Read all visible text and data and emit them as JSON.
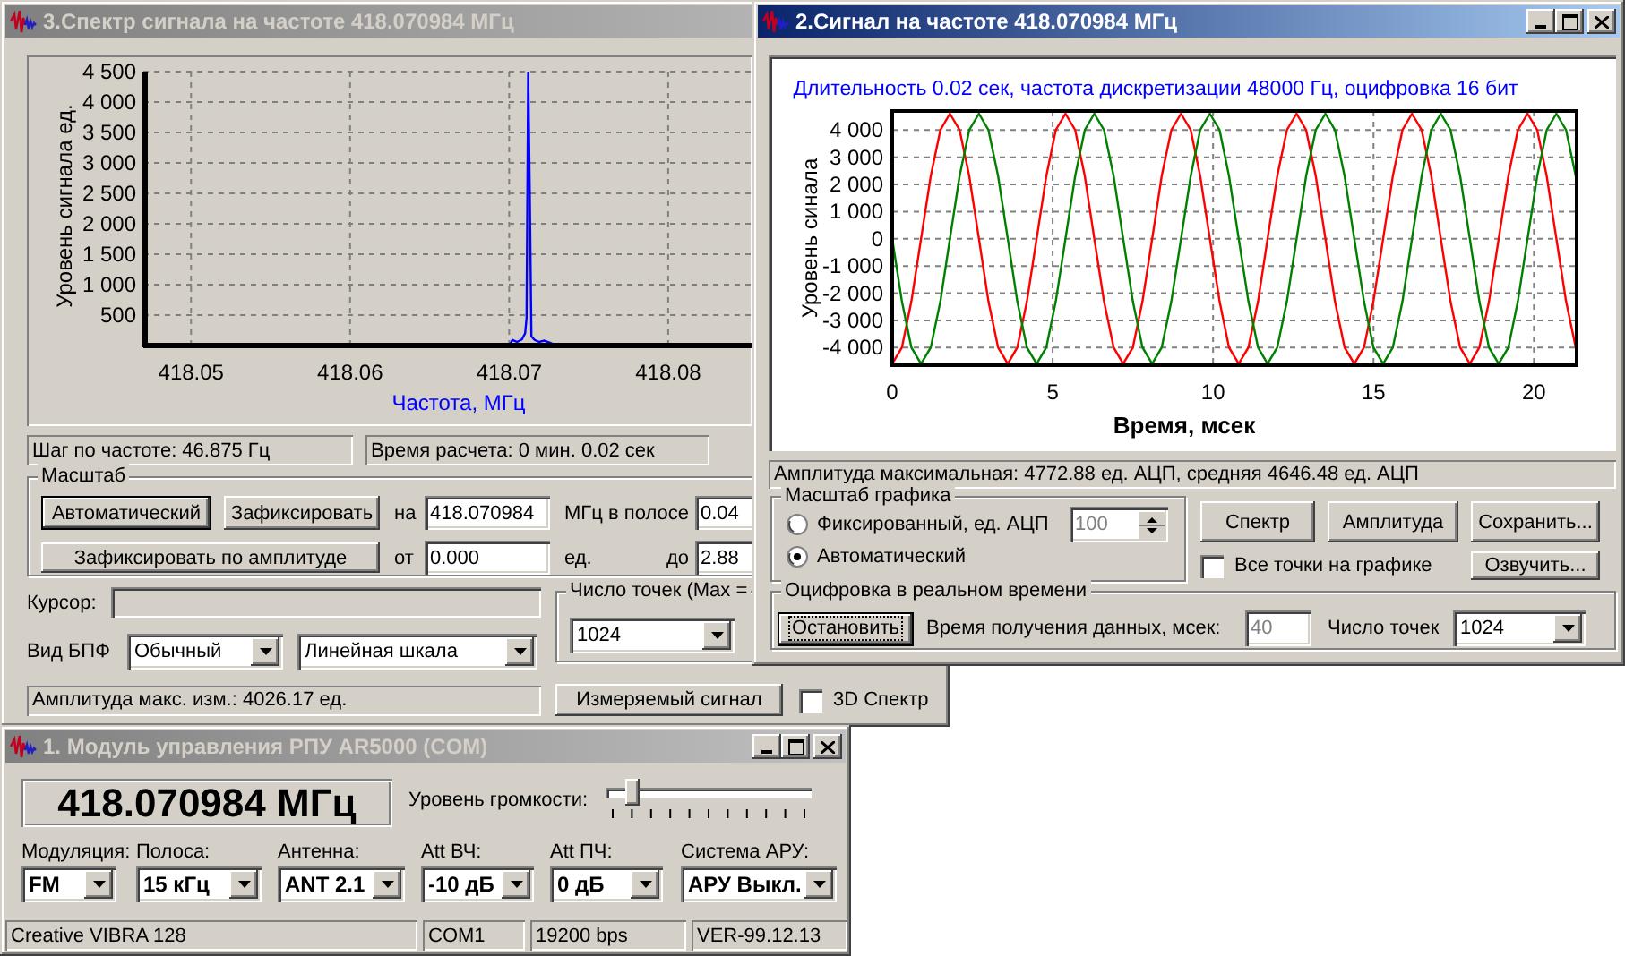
{
  "spectrum_window": {
    "title": "3.Спектр сигнала на частоте 418.070984 МГц",
    "active": false,
    "chart_data": {
      "type": "line",
      "xlabel": "Частота, МГц",
      "ylabel": "Уровень сигнала ед.",
      "x": [
        418.047,
        418.07,
        418.0702,
        418.0705,
        418.0708,
        418.071,
        418.0711,
        418.0712,
        418.0713,
        418.0714,
        418.0716,
        418.0719,
        418.0722,
        418.0726,
        418.073
      ],
      "series": [
        {
          "color": "#0000ff",
          "values": [
            0,
            0,
            90,
            60,
            100,
            200,
            450,
            4500,
            2500,
            150,
            90,
            60,
            80,
            40,
            0
          ]
        }
      ],
      "grid": true,
      "xlim": [
        418.047,
        418.0853
      ],
      "ylim": [
        0,
        4500
      ],
      "xticks": [
        418.05,
        418.06,
        418.07,
        418.08
      ],
      "yticks": [
        {
          "value": 500,
          "label": "500"
        },
        {
          "value": 1000,
          "label": "1 000"
        },
        {
          "value": 1500,
          "label": "1 500"
        },
        {
          "value": 2000,
          "label": "2 000"
        },
        {
          "value": 2500,
          "label": "2 500"
        },
        {
          "value": 3000,
          "label": "3 000"
        },
        {
          "value": 3500,
          "label": "3 500"
        },
        {
          "value": 4000,
          "label": "4 000"
        },
        {
          "value": 4500,
          "label": "4 500"
        }
      ]
    },
    "status_fields": [
      "Шаг по частоте: 46.875 Гц",
      "Время расчета: 0 мин. 0.02 сек"
    ],
    "scale_group": {
      "label": "Масштаб",
      "auto_button": "Автоматический",
      "fix_button": "Зафиксировать",
      "at_label": "на",
      "center_value": "418.070984",
      "band_label": "МГц  в полосе",
      "band_value": "0.04",
      "amp_button": "Зафиксировать по амплитуде",
      "from_label": "от",
      "from_value": "0.000",
      "units_label": "ед.",
      "to_label": "до",
      "to_value": "2.88"
    },
    "cursor_label": "Курсор:",
    "fft": {
      "label": "Вид БПФ",
      "type": "Обычный",
      "scale": "Линейная шкала"
    },
    "points_group": {
      "label": "Число точек (Max =",
      "value": "1024"
    },
    "amplitude_status": "Амплитуда макс. изм.: 4026.17 ед.",
    "signal_button": "Измеряемый сигнал",
    "spectrum_3d": {
      "label": "3D Спектр",
      "checked": false
    }
  },
  "signal_window": {
    "title": "2.Сигнал на частоте 418.070984 МГц",
    "active": true,
    "chart_data": {
      "type": "line",
      "title": "Длительность 0.02 сек, частота дискретизации 48000 Гц, оцифровка 16 бит",
      "xlabel": "Время, мсек",
      "ylabel": "Уровень синала",
      "x": [
        0,
        0.3,
        0.6,
        0.9,
        1.2,
        1.5,
        1.8,
        2.1,
        2.4,
        2.7,
        3,
        3.3,
        3.6,
        3.9,
        4.2,
        4.5,
        4.8,
        5.1,
        5.4,
        5.7,
        6,
        6.3,
        6.6,
        6.9,
        7.2,
        7.5,
        7.8,
        8.1,
        8.4,
        8.7,
        9,
        9.3,
        9.6,
        9.9,
        10.2,
        10.5,
        10.8,
        11.1,
        11.4,
        11.7,
        12,
        12.3,
        12.6,
        12.9,
        13.2,
        13.5,
        13.8,
        14.1,
        14.4,
        14.7,
        15,
        15.3,
        15.6,
        15.9,
        16.2,
        16.5,
        16.8,
        17.1,
        17.4,
        17.7,
        18,
        18.3,
        18.6,
        18.9,
        19.2,
        19.5,
        19.8,
        20.1,
        20.4,
        20.7,
        21,
        21.3
      ],
      "series": [
        {
          "color": "#ff0000",
          "values": [
            -4600,
            -4000,
            -2300,
            0,
            2300,
            4000,
            4600,
            4000,
            2300,
            0,
            -2300,
            -4000,
            -4600,
            -4000,
            -2300,
            0,
            2300,
            4000,
            4600,
            4000,
            2300,
            0,
            -2300,
            -4000,
            -4600,
            -4000,
            -2300,
            0,
            2300,
            4000,
            4600,
            4000,
            2300,
            0,
            -2300,
            -4000,
            -4600,
            -4000,
            -2300,
            0,
            2300,
            4000,
            4600,
            4000,
            2300,
            0,
            -2300,
            -4000,
            -4600,
            -4000,
            -2300,
            0,
            2300,
            4000,
            4600,
            4000,
            2300,
            0,
            -2300,
            -4000,
            -4600,
            -4000,
            -2300,
            0,
            2300,
            4000,
            4600,
            4000,
            2300,
            0,
            -2300,
            -4000
          ]
        },
        {
          "color": "#008000",
          "values": [
            0,
            -2300,
            -4000,
            -4600,
            -4000,
            -2300,
            0,
            2300,
            4000,
            4600,
            4000,
            2300,
            0,
            -2300,
            -4000,
            -4600,
            -4000,
            -2300,
            0,
            2300,
            4000,
            4600,
            4000,
            2300,
            0,
            -2300,
            -4000,
            -4600,
            -4000,
            -2300,
            0,
            2300,
            4000,
            4600,
            4000,
            2300,
            0,
            -2300,
            -4000,
            -4600,
            -4000,
            -2300,
            0,
            2300,
            4000,
            4600,
            4000,
            2300,
            0,
            -2300,
            -4000,
            -4600,
            -4000,
            -2300,
            0,
            2300,
            4000,
            4600,
            4000,
            2300,
            0,
            -2300,
            -4000,
            -4600,
            -4000,
            -2300,
            0,
            2300,
            4000,
            4600,
            4000,
            2300
          ]
        }
      ],
      "grid": true,
      "xlim": [
        0,
        21.33
      ],
      "ylim": [
        -4650,
        4700
      ],
      "xticks": [
        0,
        5,
        10,
        15,
        20
      ],
      "yticks": [
        {
          "value": -4000,
          "label": "-4 000"
        },
        {
          "value": -3000,
          "label": "-3 000"
        },
        {
          "value": -2000,
          "label": "-2 000"
        },
        {
          "value": -1000,
          "label": "-1 000"
        },
        {
          "value": 0,
          "label": "0"
        },
        {
          "value": 1000,
          "label": "1 000"
        },
        {
          "value": 2000,
          "label": "2 000"
        },
        {
          "value": 3000,
          "label": "3 000"
        },
        {
          "value": 4000,
          "label": "4 000"
        }
      ]
    },
    "amplitude_status": "Амплитуда максимальная: 4772.88 ед. АЦП, средняя 4646.48 ед. АЦП",
    "scale_group": {
      "label": "Масштаб графика",
      "options": [
        {
          "label": "Фиксированный, ед. АЦП",
          "selected": false
        },
        {
          "label": "Автоматический",
          "selected": true
        }
      ],
      "fixed_value": "100",
      "fixed_disabled": true
    },
    "buttons": [
      "Спектр",
      "Амплитуда",
      "Сохранить..."
    ],
    "all_points": {
      "label": "Все точки на графике",
      "checked": false
    },
    "sound_button": "Озвучить...",
    "realtime_group": {
      "label": "Оцифровка в реальном времени",
      "stop_button": "Остановить",
      "time_label": "Время получения данных, мсек:",
      "time_value": "40",
      "time_disabled": true,
      "points_label": "Число точек",
      "points_value": "1024"
    }
  },
  "control_window": {
    "title": "1. Модуль управления РПУ AR5000 (COM)",
    "active": false,
    "frequency": "418.070984 МГц",
    "volume": {
      "label": "Уровень громкости:",
      "level": 0.1
    },
    "selectors": [
      {
        "label": "Модуляция:",
        "value": "FM"
      },
      {
        "label": "Полоса:",
        "value": "15 кГц"
      },
      {
        "label": "Антенна:",
        "value": "ANT 2.1"
      },
      {
        "label": "Att ВЧ:",
        "value": "-10 дБ"
      },
      {
        "label": "Att ПЧ:",
        "value": "0 дБ"
      },
      {
        "label": "Система АРУ:",
        "value": "АРУ Выкл."
      }
    ],
    "status_bar": [
      "Creative VIBRA 128",
      "COM1",
      "19200 bps",
      "VER-99.12.13"
    ]
  }
}
